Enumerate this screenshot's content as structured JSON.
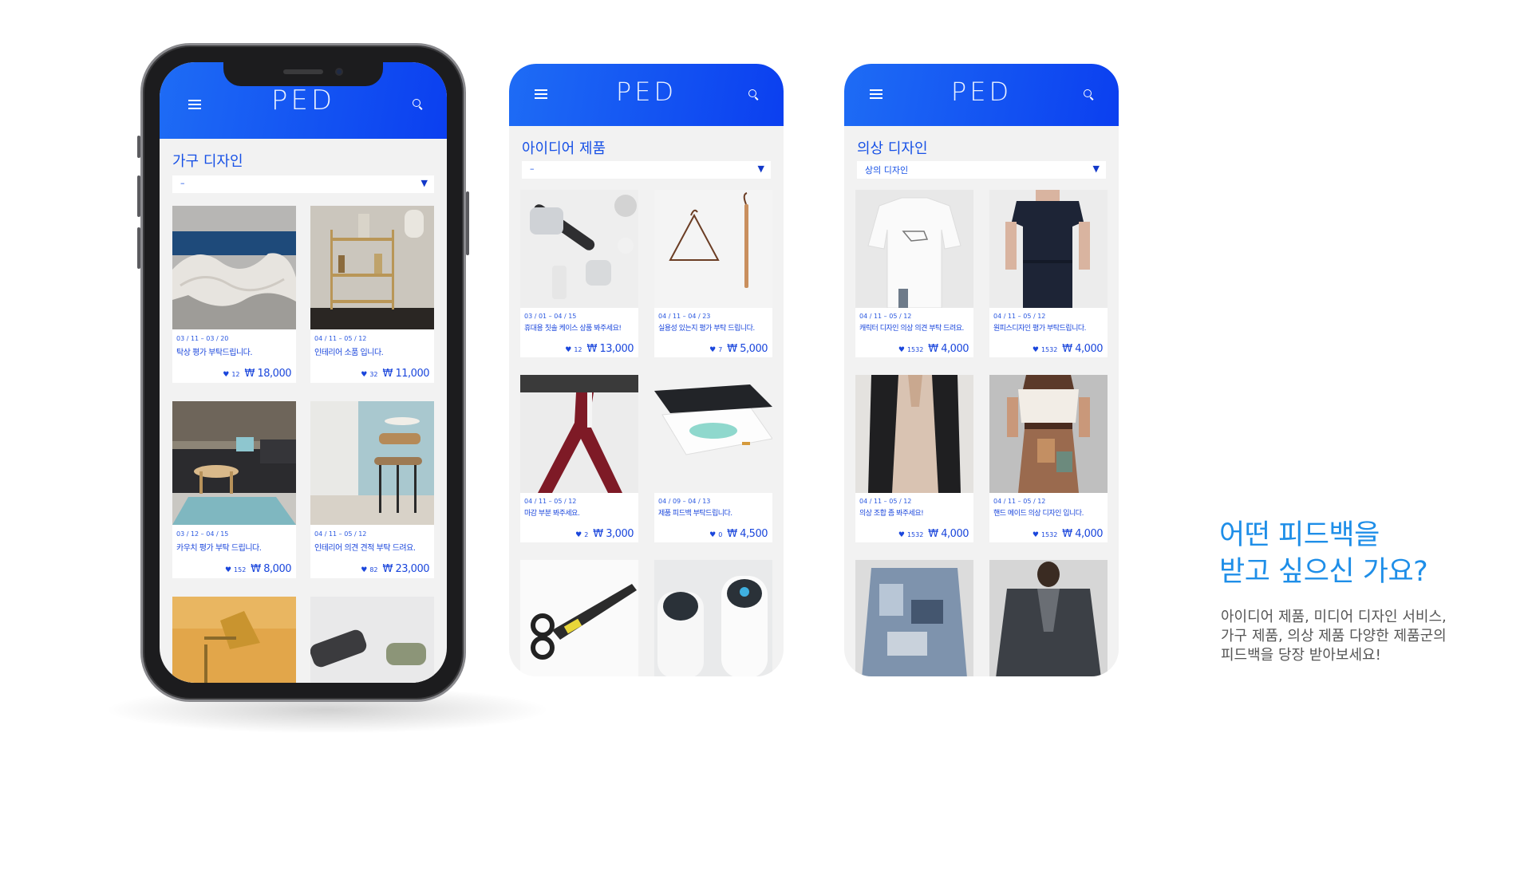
{
  "brand": {
    "logo": "PED",
    "accent": "#1650e6"
  },
  "screens": [
    {
      "category": "가구 디자인",
      "dropdown": "–",
      "cards": [
        {
          "date": "03 / 11 – 03 / 20",
          "name": "탁상 평가 부탁드립니다.",
          "likes": "12",
          "price": "₩ 18,000"
        },
        {
          "date": "04 / 11 – 05 / 12",
          "name": "인테리어 소품 입니다.",
          "likes": "32",
          "price": "₩ 11,000"
        },
        {
          "date": "03 / 12 – 04 / 15",
          "name": "카우치 평가 부탁 드립니다.",
          "likes": "152",
          "price": "₩ 8,000"
        },
        {
          "date": "04 / 11 – 05 / 12",
          "name": "인테리어 의견 견적 부탁 드려요.",
          "likes": "82",
          "price": "₩ 23,000"
        },
        {
          "date": "",
          "name": "",
          "likes": "",
          "price": ""
        },
        {
          "date": "",
          "name": "",
          "likes": "",
          "price": ""
        }
      ]
    },
    {
      "category": "아이디어 제품",
      "dropdown": "–",
      "cards": [
        {
          "date": "03 / 01 – 04 / 15",
          "name": "휴대용 칫솔 케이스 상품 봐주세요!",
          "likes": "12",
          "price": "₩ 13,000"
        },
        {
          "date": "04 /  11 – 04 / 23",
          "name": "실용성 있는지 평가 부탁 드립니다.",
          "likes": "7",
          "price": "₩ 5,000"
        },
        {
          "date": "04 / 11 – 05 / 12",
          "name": "마감 부분 봐주세요.",
          "likes": "2",
          "price": "₩ 3,000"
        },
        {
          "date": "04 / 09 – 04 / 13",
          "name": "제품 피드백 부탁드립니다.",
          "likes": "0",
          "price": "₩ 4,500"
        },
        {
          "date": "",
          "name": "",
          "likes": "",
          "price": ""
        },
        {
          "date": "",
          "name": "",
          "likes": "",
          "price": ""
        }
      ]
    },
    {
      "category": "의상 디자인",
      "dropdown": "상의 디자인",
      "cards": [
        {
          "date": "04 / 11 – 05 / 12",
          "name": "캐릭터 디자인 의상 의견 부탁 드려요.",
          "likes": "1532",
          "price": "₩ 4,000"
        },
        {
          "date": "04 / 11 – 05 / 12",
          "name": "원피스디자인 평가 부탁드립니다.",
          "likes": "1532",
          "price": "₩ 4,000"
        },
        {
          "date": "04 / 11 – 05 / 12",
          "name": "의상 조합 좀 봐주세요!",
          "likes": "1532",
          "price": "₩ 4,000"
        },
        {
          "date": "04 / 11 – 05 / 12",
          "name": "핸드 메이드 의상 디자인 입니다.",
          "likes": "1532",
          "price": "₩ 4,000"
        },
        {
          "date": "",
          "name": "",
          "likes": "",
          "price": ""
        },
        {
          "date": "",
          "name": "",
          "likes": "",
          "price": ""
        }
      ]
    }
  ],
  "tagline": {
    "title_line1": "어떤 피드백을",
    "title_line2": "받고 싶으신 가요?",
    "desc_line1": "아이디어 제품, 미디어 디자인 서비스,",
    "desc_line2": "가구 제품, 의상 제품 다양한 제품군의",
    "desc_line3": "피드백을 당장 받아보세요!"
  },
  "icons": {
    "menu": "hamburger-icon",
    "search": "search-icon",
    "like": "heart-icon",
    "dropdown": "caret-down-icon"
  }
}
